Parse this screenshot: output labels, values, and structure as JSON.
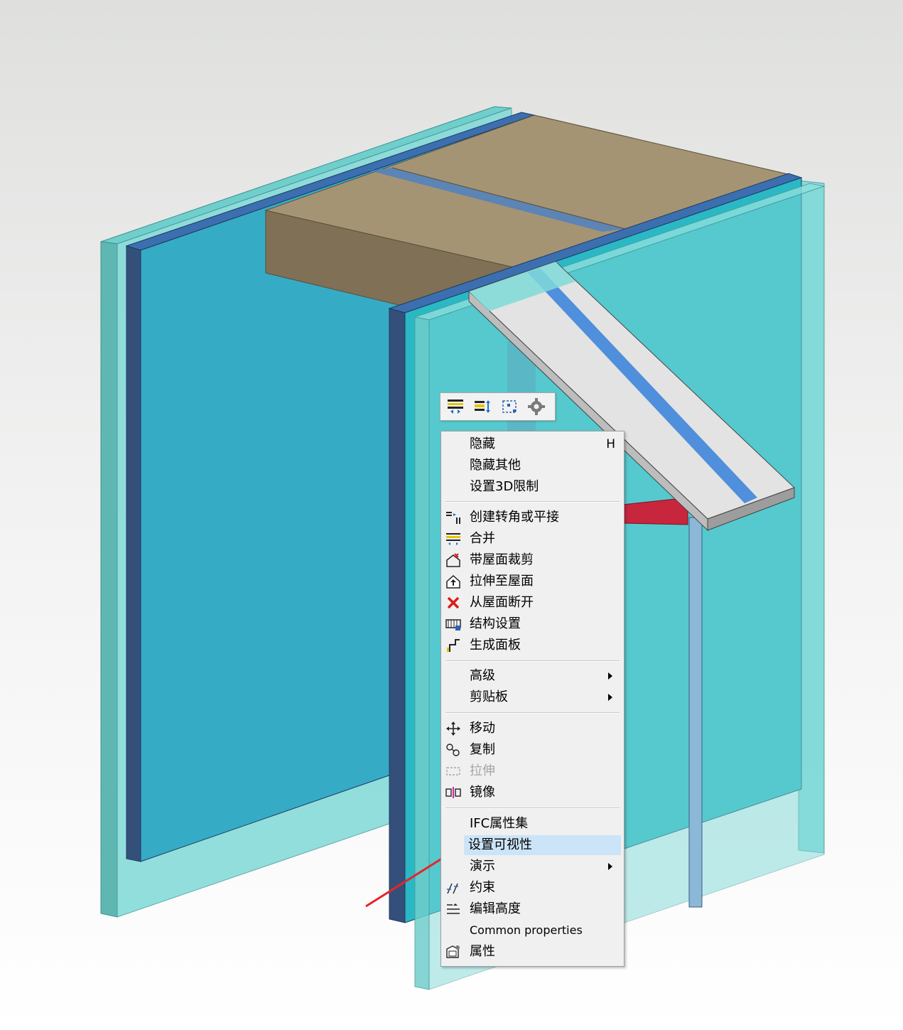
{
  "colors": {
    "wall_cyan": "#2bb8c5",
    "glass": "#7fdad8",
    "wall_edge": "#34507a",
    "roof_tan": "#a59473",
    "beam_grey": "#e3e3e3",
    "menu_bg": "#f0f0f0",
    "highlight": "#cce4f7",
    "arrow_red": "#e8242a"
  },
  "mini_toolbar": {
    "buttons": [
      {
        "name": "merge-roof-icon"
      },
      {
        "name": "split-icon"
      },
      {
        "name": "select-points-icon"
      },
      {
        "name": "gear-icon"
      }
    ]
  },
  "menu": {
    "hide": {
      "label": "隐藏",
      "shortcut": "H"
    },
    "hide_others": "隐藏其他",
    "set_3d_limit": "设置3D限制",
    "create_corner": "创建转角或平接",
    "merge": "合并",
    "roof_trim": "带屋面裁剪",
    "extend_to_roof": "拉伸至屋面",
    "detach_roof": "从屋面断开",
    "structure_settings": "结构设置",
    "generate_panels": "生成面板",
    "advanced": "高级",
    "clipboard": "剪贴板",
    "move": "移动",
    "copy": "复制",
    "stretch": "拉伸",
    "mirror": "镜像",
    "ifc_property_sets": "IFC属性集",
    "set_visibility": "设置可视性",
    "presentation": "演示",
    "constraints": "约束",
    "edit_height": "编辑高度",
    "common_properties": "Common properties",
    "properties": "属性"
  }
}
